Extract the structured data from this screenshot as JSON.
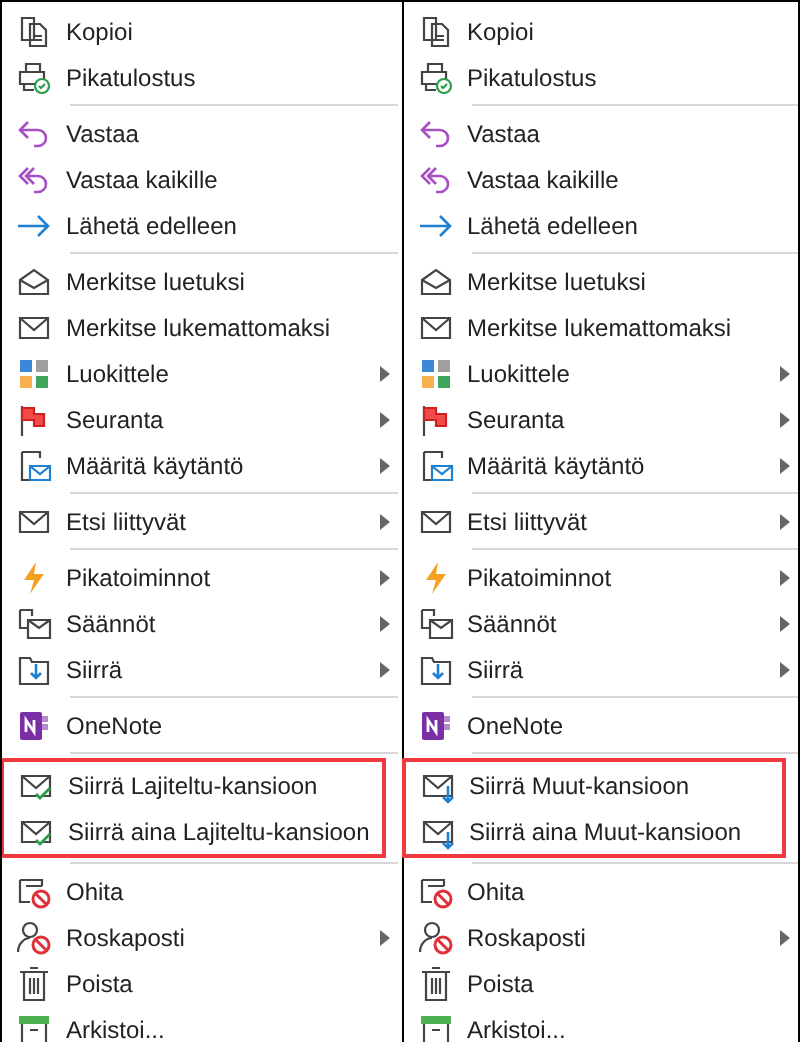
{
  "menus": [
    {
      "sections": [
        {
          "highlighted": false,
          "items": [
            {
              "label": "Kopioi",
              "kind": "copy",
              "submenu": false
            },
            {
              "label": "Pikatulostus",
              "kind": "print",
              "submenu": false
            }
          ]
        },
        {
          "highlighted": false,
          "items": [
            {
              "label": "Vastaa",
              "kind": "reply",
              "submenu": false
            },
            {
              "label": "Vastaa kaikille",
              "kind": "replyall",
              "submenu": false
            },
            {
              "label": "Lähetä edelleen",
              "kind": "forward",
              "submenu": false
            }
          ]
        },
        {
          "highlighted": false,
          "items": [
            {
              "label": "Merkitse luetuksi",
              "kind": "open-mail",
              "submenu": false
            },
            {
              "label": "Merkitse lukemattomaksi",
              "kind": "mail",
              "submenu": false
            },
            {
              "label": "Luokittele",
              "kind": "categorize",
              "submenu": true
            },
            {
              "label": "Seuranta",
              "kind": "flag",
              "submenu": true
            },
            {
              "label": "Määritä käytäntö",
              "kind": "policy",
              "submenu": true
            }
          ]
        },
        {
          "highlighted": false,
          "items": [
            {
              "label": "Etsi liittyvät",
              "kind": "mail",
              "submenu": true
            }
          ]
        },
        {
          "highlighted": false,
          "items": [
            {
              "label": "Pikatoiminnot",
              "kind": "bolt",
              "submenu": true
            },
            {
              "label": "Säännöt",
              "kind": "rules",
              "submenu": true
            },
            {
              "label": "Siirrä",
              "kind": "move",
              "submenu": true
            }
          ]
        },
        {
          "highlighted": false,
          "items": [
            {
              "label": "OneNote",
              "kind": "note",
              "submenu": false
            }
          ]
        },
        {
          "highlighted": true,
          "items": [
            {
              "label": "Siirrä Lajiteltu-kansioon",
              "kind": "mail-check",
              "submenu": false
            },
            {
              "label": "Siirrä aina Lajiteltu-kansioon",
              "kind": "mail-check",
              "submenu": false
            }
          ]
        },
        {
          "highlighted": false,
          "items": [
            {
              "label": "Ohita",
              "kind": "ignore",
              "submenu": false
            },
            {
              "label": "Roskaposti",
              "kind": "junk",
              "submenu": true
            },
            {
              "label": "Poista",
              "kind": "trash",
              "submenu": false
            },
            {
              "label": "Arkistoi...",
              "kind": "archive",
              "submenu": false
            }
          ]
        }
      ]
    },
    {
      "sections": [
        {
          "highlighted": false,
          "items": [
            {
              "label": "Kopioi",
              "kind": "copy",
              "submenu": false
            },
            {
              "label": "Pikatulostus",
              "kind": "print",
              "submenu": false
            }
          ]
        },
        {
          "highlighted": false,
          "items": [
            {
              "label": "Vastaa",
              "kind": "reply",
              "submenu": false
            },
            {
              "label": "Vastaa kaikille",
              "kind": "replyall",
              "submenu": false
            },
            {
              "label": "Lähetä edelleen",
              "kind": "forward",
              "submenu": false
            }
          ]
        },
        {
          "highlighted": false,
          "items": [
            {
              "label": "Merkitse luetuksi",
              "kind": "open-mail",
              "submenu": false
            },
            {
              "label": "Merkitse lukemattomaksi",
              "kind": "mail",
              "submenu": false
            },
            {
              "label": "Luokittele",
              "kind": "categorize",
              "submenu": true
            },
            {
              "label": "Seuranta",
              "kind": "flag",
              "submenu": true
            },
            {
              "label": "Määritä käytäntö",
              "kind": "policy",
              "submenu": true
            }
          ]
        },
        {
          "highlighted": false,
          "items": [
            {
              "label": "Etsi liittyvät",
              "kind": "mail",
              "submenu": true
            }
          ]
        },
        {
          "highlighted": false,
          "items": [
            {
              "label": "Pikatoiminnot",
              "kind": "bolt",
              "submenu": true
            },
            {
              "label": "Säännöt",
              "kind": "rules",
              "submenu": true
            },
            {
              "label": "Siirrä",
              "kind": "move",
              "submenu": true
            }
          ]
        },
        {
          "highlighted": false,
          "items": [
            {
              "label": "OneNote",
              "kind": "note",
              "submenu": false
            }
          ]
        },
        {
          "highlighted": true,
          "items": [
            {
              "label": "Siirrä Muut-kansioon",
              "kind": "mail-down",
              "submenu": false
            },
            {
              "label": "Siirrä aina Muut-kansioon",
              "kind": "mail-down",
              "submenu": false
            }
          ]
        },
        {
          "highlighted": false,
          "items": [
            {
              "label": "Ohita",
              "kind": "ignore",
              "submenu": false
            },
            {
              "label": "Roskaposti",
              "kind": "junk",
              "submenu": true
            },
            {
              "label": "Poista",
              "kind": "trash",
              "submenu": false
            },
            {
              "label": "Arkistoi...",
              "kind": "archive",
              "submenu": false
            }
          ]
        }
      ]
    }
  ]
}
